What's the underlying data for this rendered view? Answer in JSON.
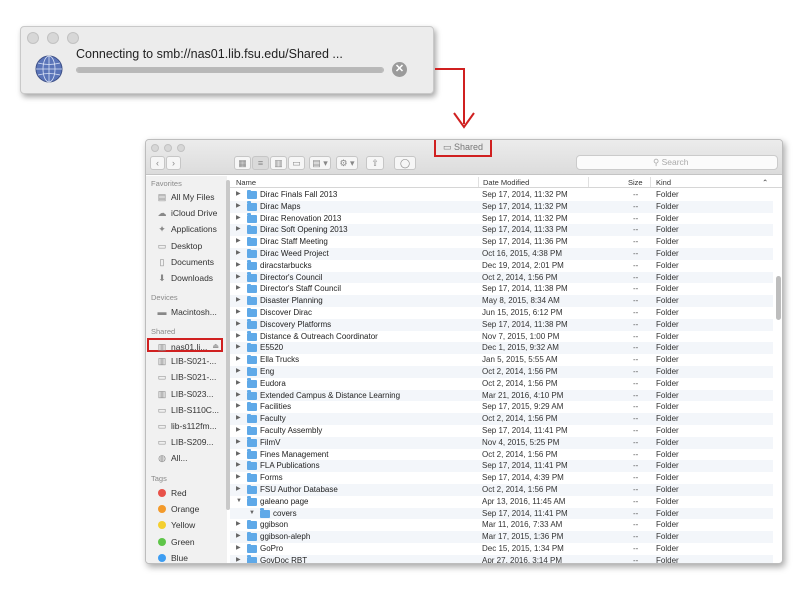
{
  "connect_dialog": {
    "message": "Connecting to smb://nas01.lib.fsu.edu/Shared ...",
    "cancel_symbol": "✕",
    "globe_icon": "network-globe-icon"
  },
  "finder": {
    "title": "Shared",
    "search_placeholder": "Search",
    "toolbar": {
      "back": "‹",
      "forward": "›",
      "icon_view": "▦",
      "list_view": "≡",
      "column_view": "▥",
      "cover_view": "▭",
      "arrange": "▤ ▾",
      "action": "⚙ ▾",
      "share": "⇧",
      "tags": "◯"
    },
    "sidebar": {
      "favorites_label": "Favorites",
      "favorites": [
        {
          "label": "All My Files",
          "icon": "all-files-icon"
        },
        {
          "label": "iCloud Drive",
          "icon": "cloud-icon"
        },
        {
          "label": "Applications",
          "icon": "applications-icon"
        },
        {
          "label": "Desktop",
          "icon": "desktop-icon"
        },
        {
          "label": "Documents",
          "icon": "documents-icon"
        },
        {
          "label": "Downloads",
          "icon": "downloads-icon"
        }
      ],
      "devices_label": "Devices",
      "devices": [
        {
          "label": "Macintosh...",
          "icon": "disk-icon"
        }
      ],
      "shared_label": "Shared",
      "shared": [
        {
          "label": "nas01.li...",
          "icon": "server-icon",
          "eject": "⏏"
        },
        {
          "label": "LIB-S021-...",
          "icon": "server-icon"
        },
        {
          "label": "LIB-S021-...",
          "icon": "computer-icon"
        },
        {
          "label": "LIB-S023...",
          "icon": "server-icon"
        },
        {
          "label": "LIB-S110C...",
          "icon": "computer-icon"
        },
        {
          "label": "lib-s112fm...",
          "icon": "computer-icon"
        },
        {
          "label": "LIB-S209...",
          "icon": "computer-icon"
        },
        {
          "label": "All...",
          "icon": "globe-icon"
        }
      ],
      "tags_label": "Tags",
      "tags": [
        {
          "label": "Red",
          "color": "#e8524a"
        },
        {
          "label": "Orange",
          "color": "#f39a2b"
        },
        {
          "label": "Yellow",
          "color": "#f4cf2f"
        },
        {
          "label": "Green",
          "color": "#5fc549"
        },
        {
          "label": "Blue",
          "color": "#3d9df2"
        }
      ]
    },
    "columns": {
      "name": "Name",
      "date": "Date Modified",
      "size": "Size",
      "kind": "Kind",
      "sort_indicator": "⌃"
    },
    "rows": [
      {
        "name": "Dirac Finals Fall 2013",
        "date": "Sep 17, 2014, 11:32 PM",
        "size": "--",
        "kind": "Folder"
      },
      {
        "name": "Dirac Maps",
        "date": "Sep 17, 2014, 11:32 PM",
        "size": "--",
        "kind": "Folder"
      },
      {
        "name": "Dirac Renovation 2013",
        "date": "Sep 17, 2014, 11:32 PM",
        "size": "--",
        "kind": "Folder"
      },
      {
        "name": "Dirac Soft Opening 2013",
        "date": "Sep 17, 2014, 11:33 PM",
        "size": "--",
        "kind": "Folder"
      },
      {
        "name": "Dirac Staff Meeting",
        "date": "Sep 17, 2014, 11:36 PM",
        "size": "--",
        "kind": "Folder"
      },
      {
        "name": "Dirac Weed Project",
        "date": "Oct 16, 2015, 4:38 PM",
        "size": "--",
        "kind": "Folder"
      },
      {
        "name": "diracstarbucks",
        "date": "Dec 19, 2014, 2:01 PM",
        "size": "--",
        "kind": "Folder"
      },
      {
        "name": "Director's Council",
        "date": "Oct 2, 2014, 1:56 PM",
        "size": "--",
        "kind": "Folder"
      },
      {
        "name": "Director's Staff Council",
        "date": "Sep 17, 2014, 11:38 PM",
        "size": "--",
        "kind": "Folder"
      },
      {
        "name": "Disaster Planning",
        "date": "May 8, 2015, 8:34 AM",
        "size": "--",
        "kind": "Folder"
      },
      {
        "name": "Discover Dirac",
        "date": "Jun 15, 2015, 6:12 PM",
        "size": "--",
        "kind": "Folder"
      },
      {
        "name": "Discovery Platforms",
        "date": "Sep 17, 2014, 11:38 PM",
        "size": "--",
        "kind": "Folder"
      },
      {
        "name": "Distance & Outreach Coordinator",
        "date": "Nov 7, 2015, 1:00 PM",
        "size": "--",
        "kind": "Folder"
      },
      {
        "name": "E5520",
        "date": "Dec 1, 2015, 9:32 AM",
        "size": "--",
        "kind": "Folder"
      },
      {
        "name": "Ella Trucks",
        "date": "Jan 5, 2015, 5:55 AM",
        "size": "--",
        "kind": "Folder"
      },
      {
        "name": "Eng",
        "date": "Oct 2, 2014, 1:56 PM",
        "size": "--",
        "kind": "Folder"
      },
      {
        "name": "Eudora",
        "date": "Oct 2, 2014, 1:56 PM",
        "size": "--",
        "kind": "Folder"
      },
      {
        "name": "Extended Campus & Distance Learning",
        "date": "Mar 21, 2016, 4:10 PM",
        "size": "--",
        "kind": "Folder"
      },
      {
        "name": "Facilities",
        "date": "Sep 17, 2015, 9:29 AM",
        "size": "--",
        "kind": "Folder"
      },
      {
        "name": "Faculty",
        "date": "Oct 2, 2014, 1:56 PM",
        "size": "--",
        "kind": "Folder"
      },
      {
        "name": "Faculty Assembly",
        "date": "Sep 17, 2014, 11:41 PM",
        "size": "--",
        "kind": "Folder"
      },
      {
        "name": "FilmV",
        "date": "Nov 4, 2015, 5:25 PM",
        "size": "--",
        "kind": "Folder"
      },
      {
        "name": "Fines Management",
        "date": "Oct 2, 2014, 1:56 PM",
        "size": "--",
        "kind": "Folder"
      },
      {
        "name": "FLA Publications",
        "date": "Sep 17, 2014, 11:41 PM",
        "size": "--",
        "kind": "Folder"
      },
      {
        "name": "Forms",
        "date": "Sep 17, 2014, 4:39 PM",
        "size": "--",
        "kind": "Folder"
      },
      {
        "name": "FSU Author Database",
        "date": "Oct 2, 2014, 1:56 PM",
        "size": "--",
        "kind": "Folder"
      },
      {
        "name": "galeano page",
        "date": "Apr 13, 2016, 11:45 AM",
        "size": "--",
        "kind": "Folder",
        "expanded": true
      },
      {
        "name": "covers",
        "date": "Sep 17, 2014, 11:41 PM",
        "size": "--",
        "kind": "Folder",
        "sub": true
      },
      {
        "name": "ggibson",
        "date": "Mar 11, 2016, 7:33 AM",
        "size": "--",
        "kind": "Folder"
      },
      {
        "name": "ggibson-aleph",
        "date": "Mar 17, 2015, 1:36 PM",
        "size": "--",
        "kind": "Folder"
      },
      {
        "name": "GoPro",
        "date": "Dec 15, 2015, 1:34 PM",
        "size": "--",
        "kind": "Folder"
      },
      {
        "name": "GovDoc RBT",
        "date": "Apr 27, 2016, 3:14 PM",
        "size": "--",
        "kind": "Folder"
      }
    ]
  }
}
